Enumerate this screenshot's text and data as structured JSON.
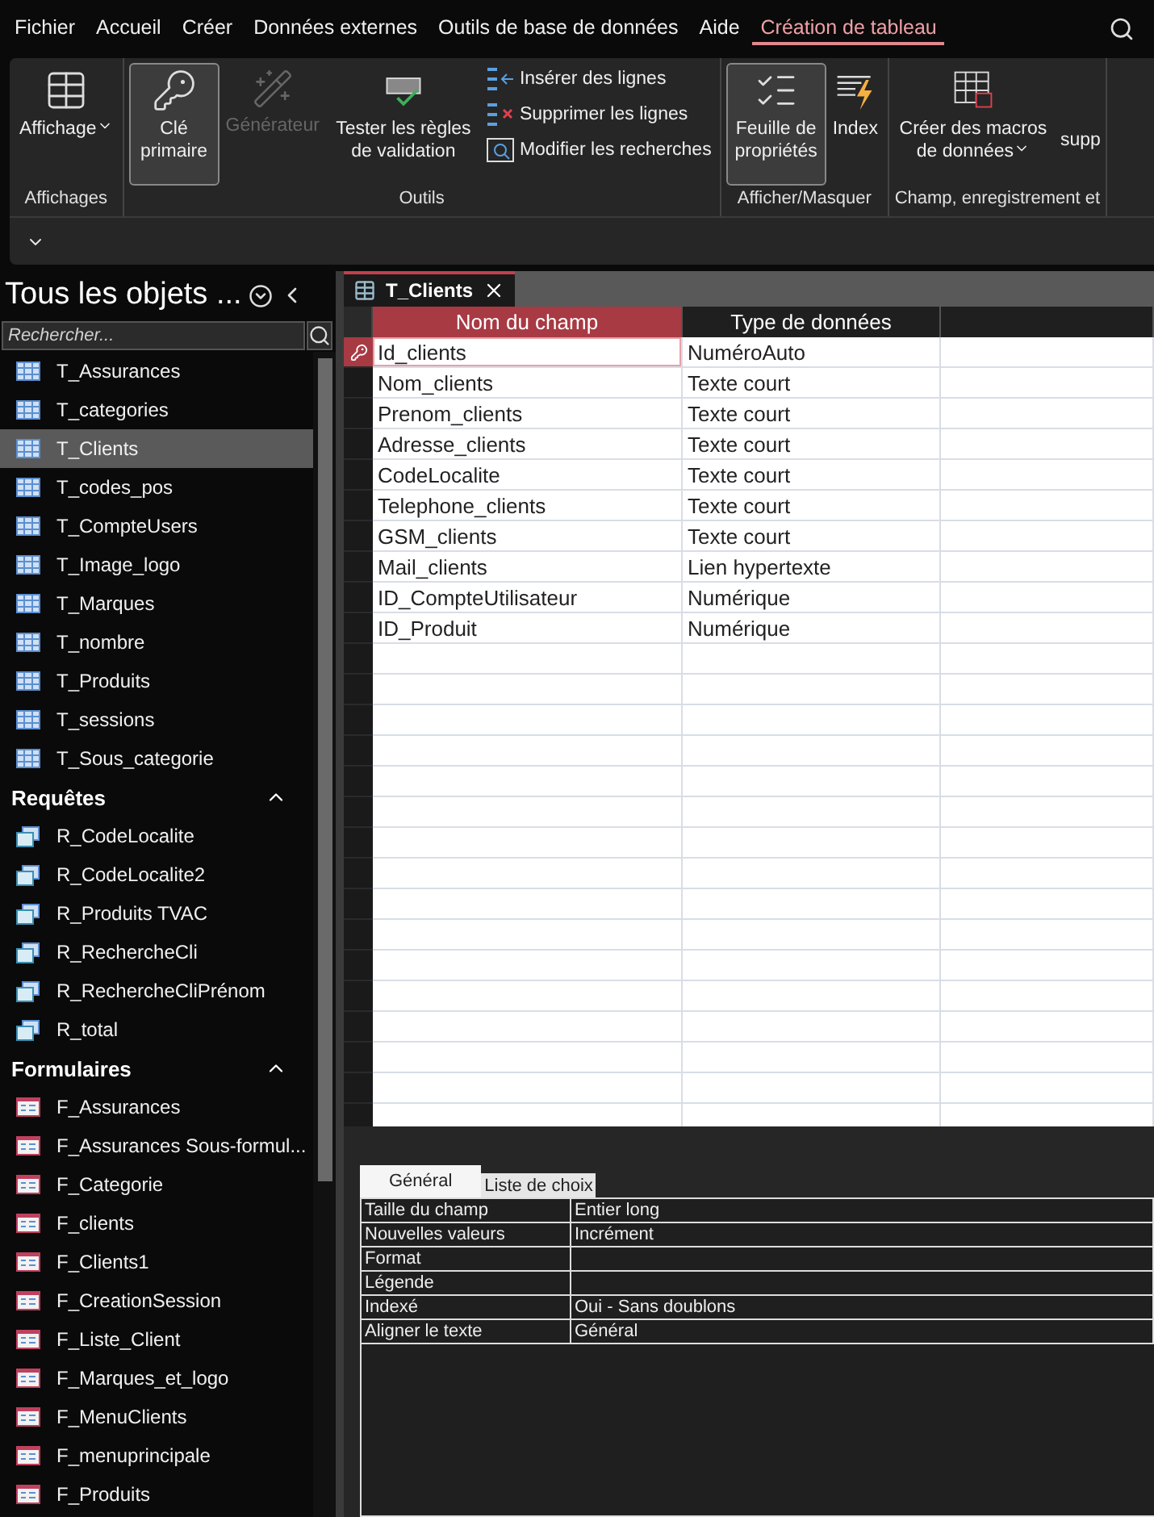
{
  "menu": [
    {
      "label": "Fichier",
      "selected": false
    },
    {
      "label": "Accueil",
      "selected": false
    },
    {
      "label": "Créer",
      "selected": false
    },
    {
      "label": "Données externes",
      "selected": false
    },
    {
      "label": "Outils de base de données",
      "selected": false
    },
    {
      "label": "Aide",
      "selected": false
    },
    {
      "label": "Création de tableau",
      "selected": true
    }
  ],
  "ribbon": {
    "groups": [
      {
        "label": "Affichages",
        "buttons": [
          {
            "kind": "large",
            "label": "Affichage",
            "dropdown": true,
            "pressed": false,
            "disabled": false
          }
        ]
      },
      {
        "label": "Outils",
        "buttons": [
          {
            "kind": "large",
            "label": "Clé primaire",
            "pressed": true,
            "disabled": false
          },
          {
            "kind": "large",
            "label": "Générateur",
            "pressed": false,
            "disabled": true
          },
          {
            "kind": "large",
            "label": "Tester les règles de validation",
            "pressed": false,
            "disabled": false
          },
          {
            "kind": "small",
            "label": "Insérer des lignes",
            "disabled": false
          },
          {
            "kind": "small",
            "label": "Supprimer les lignes",
            "disabled": false
          },
          {
            "kind": "small",
            "label": "Modifier les recherches",
            "disabled": false
          }
        ]
      },
      {
        "label": "Afficher/Masquer",
        "buttons": [
          {
            "kind": "large",
            "label": "Feuille de propriétés",
            "pressed": true,
            "disabled": false
          },
          {
            "kind": "large",
            "label": "Index",
            "pressed": false,
            "disabled": false
          }
        ]
      },
      {
        "label": "Champ, enregistrement et",
        "buttons": [
          {
            "kind": "large",
            "label": "Créer des macros de données",
            "dropdown": true,
            "pressed": false,
            "disabled": false
          },
          {
            "kind": "cut",
            "label": "supp"
          }
        ]
      }
    ]
  },
  "nav": {
    "title": "Tous les objets ...",
    "search": {
      "placeholder": "Rechercher..."
    },
    "sections": [
      {
        "kind": "table",
        "items": [
          {
            "label": "T_Assurances",
            "selected": false
          },
          {
            "label": "T_categories",
            "selected": false
          },
          {
            "label": "T_Clients",
            "selected": true
          },
          {
            "label": "T_codes_pos",
            "selected": false
          },
          {
            "label": "T_CompteUsers",
            "selected": false
          },
          {
            "label": "T_Image_logo",
            "selected": false
          },
          {
            "label": "T_Marques",
            "selected": false
          },
          {
            "label": "T_nombre",
            "selected": false
          },
          {
            "label": "T_Produits",
            "selected": false
          },
          {
            "label": "T_sessions",
            "selected": false
          },
          {
            "label": "T_Sous_categorie",
            "selected": false
          }
        ]
      },
      {
        "title": "Requêtes",
        "kind": "query",
        "items": [
          {
            "label": "R_CodeLocalite",
            "selected": false
          },
          {
            "label": "R_CodeLocalite2",
            "selected": false
          },
          {
            "label": "R_Produits TVAC",
            "selected": false
          },
          {
            "label": "R_RechercheCli",
            "selected": false
          },
          {
            "label": "R_RechercheCliPrénom",
            "selected": false
          },
          {
            "label": "R_total",
            "selected": false
          }
        ]
      },
      {
        "title": "Formulaires",
        "kind": "form",
        "items": [
          {
            "label": "F_Assurances",
            "selected": false
          },
          {
            "label": "F_Assurances Sous-formul...",
            "selected": false
          },
          {
            "label": "F_Categorie",
            "selected": false
          },
          {
            "label": "F_clients",
            "selected": false
          },
          {
            "label": "F_Clients1",
            "selected": false
          },
          {
            "label": "F_CreationSession",
            "selected": false
          },
          {
            "label": "F_Liste_Client",
            "selected": false
          },
          {
            "label": "F_Marques_et_logo",
            "selected": false
          },
          {
            "label": "F_MenuClients",
            "selected": false
          },
          {
            "label": "F_menuprincipale",
            "selected": false
          },
          {
            "label": "F_Produits",
            "selected": false
          }
        ]
      }
    ]
  },
  "document_tab": {
    "label": "T_Clients"
  },
  "design_grid": {
    "columns": [
      "Nom du champ",
      "Type de données"
    ],
    "rows": [
      {
        "field": "Id_clients",
        "type": "NuméroAuto",
        "primary_key": true,
        "selected": true
      },
      {
        "field": "Nom_clients",
        "type": "Texte court",
        "primary_key": false,
        "selected": false
      },
      {
        "field": "Prenom_clients",
        "type": "Texte court",
        "primary_key": false,
        "selected": false
      },
      {
        "field": "Adresse_clients",
        "type": "Texte court",
        "primary_key": false,
        "selected": false
      },
      {
        "field": "CodeLocalite",
        "type": "Texte court",
        "primary_key": false,
        "selected": false
      },
      {
        "field": "Telephone_clients",
        "type": "Texte court",
        "primary_key": false,
        "selected": false
      },
      {
        "field": "GSM_clients",
        "type": "Texte court",
        "primary_key": false,
        "selected": false
      },
      {
        "field": "Mail_clients",
        "type": "Lien hypertexte",
        "primary_key": false,
        "selected": false
      },
      {
        "field": "ID_CompteUtilisateur",
        "type": "Numérique",
        "primary_key": false,
        "selected": false
      },
      {
        "field": "ID_Produit",
        "type": "Numérique",
        "primary_key": false,
        "selected": false
      }
    ]
  },
  "field_properties": {
    "tabs": [
      {
        "label": "Général",
        "selected": true
      },
      {
        "label": "Liste de choix",
        "selected": false
      }
    ],
    "rows": [
      {
        "name": "Taille du champ",
        "value": "Entier long"
      },
      {
        "name": "Nouvelles valeurs",
        "value": "Incrément"
      },
      {
        "name": "Format"
      },
      {
        "name": "Légende"
      },
      {
        "name": "Indexé",
        "value": "Oui - Sans doublons"
      },
      {
        "name": "Aligner le texte",
        "value": "Général"
      }
    ]
  }
}
